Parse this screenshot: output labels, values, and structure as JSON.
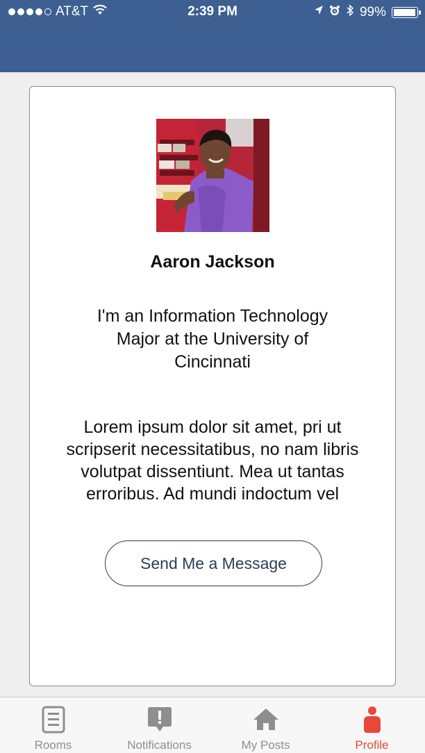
{
  "status_bar": {
    "carrier": "AT&T",
    "time": "2:39 PM",
    "battery": "99%",
    "battery_level": 0.99,
    "signal_bars_filled": 4,
    "signal_bars_total": 5
  },
  "profile": {
    "name": "Aaron Jackson",
    "tagline": "I'm an Information Technology Major at the University of Cincinnati",
    "bio": "Lorem ipsum dolor sit amet, pri ut scripserit necessitatibus, no nam libris volutpat dissentiunt. Mea ut tantas erroribus. Ad mundi indoctum vel",
    "button_label": "Send Me a Message"
  },
  "tabs": [
    {
      "label": "Rooms",
      "icon": "document-icon",
      "active": false
    },
    {
      "label": "Notifications",
      "icon": "alert-bubble-icon",
      "active": false
    },
    {
      "label": "My Posts",
      "icon": "home-icon",
      "active": false
    },
    {
      "label": "Profile",
      "icon": "person-icon",
      "active": true
    }
  ],
  "colors": {
    "header": "#3d5f92",
    "accent_active": "#e8473a",
    "tab_inactive": "#8e8e8e",
    "button_text": "#2b3e55"
  }
}
